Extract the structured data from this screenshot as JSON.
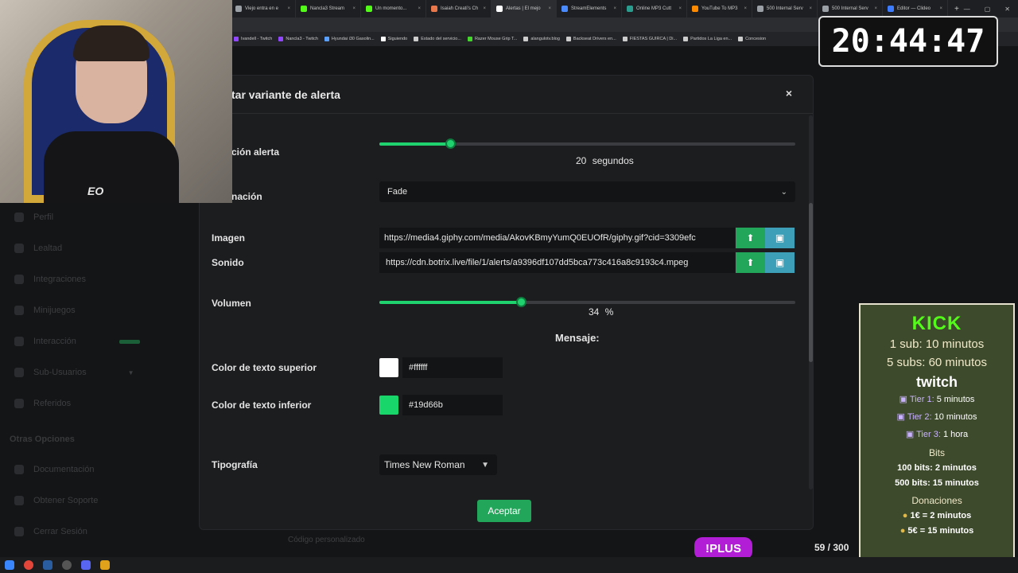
{
  "browser": {
    "tabs": [
      {
        "label": "Viejo entra en e",
        "color": "#9aa0a6"
      },
      {
        "label": "Nancla3 Stream",
        "color": "#53fc18"
      },
      {
        "label": "Un momento...",
        "color": "#53fc18"
      },
      {
        "label": "Isaiah Creati's Ch",
        "color": "#e8774c"
      },
      {
        "label": "Alertas | El mejo",
        "color": "#ffffff",
        "active": true
      },
      {
        "label": "StreamElements",
        "color": "#4a8cff"
      },
      {
        "label": "Online MP3 Cutt",
        "color": "#2a9d8f"
      },
      {
        "label": "YouTube To MP3",
        "color": "#ff8a00"
      },
      {
        "label": "500 Internal Serv",
        "color": "#9aa0a6"
      },
      {
        "label": "500 Internal Serv",
        "color": "#9aa0a6"
      },
      {
        "label": "Editor — Clideo",
        "color": "#3d7cff"
      }
    ],
    "new_tab": "+",
    "window_controls": [
      "—",
      "▢",
      "✕"
    ],
    "bookmarks": [
      {
        "label": "Ivandell - Twitch",
        "color": "#9146ff"
      },
      {
        "label": "Nancla3 - Twitch",
        "color": "#9146ff"
      },
      {
        "label": "Hyundai i30 Gasolin...",
        "color": "#5aa0ff"
      },
      {
        "label": "Siguiendo",
        "color": "#ffffff"
      },
      {
        "label": "Estado del servicio...",
        "color": "#cccccc"
      },
      {
        "label": "Razer Mouse Grip T...",
        "color": "#44d62c"
      },
      {
        "label": "alangulotv.blog",
        "color": "#cccccc"
      },
      {
        "label": "Backseat Drivers en...",
        "color": "#cccccc"
      },
      {
        "label": "FIESTAS GUIRCA | Di...",
        "color": "#cccccc"
      },
      {
        "label": "Partidos La Liga en...",
        "color": "#cccccc"
      },
      {
        "label": "Concesion",
        "color": "#cccccc"
      }
    ]
  },
  "sidebar": {
    "items": [
      "Perfil",
      "Lealtad",
      "Integraciones",
      "Minijuegos",
      "Interacción",
      "Sub-Usuarios",
      "Referidos"
    ],
    "section_title": "Otras Opciones",
    "bottom_items": [
      "Documentación",
      "Obtener Soporte",
      "Cerrar Sesión"
    ]
  },
  "modal": {
    "title": "tar variante de alerta",
    "close": "×",
    "duration": {
      "label": "ción alerta",
      "value_number": "20",
      "value_unit": "segundos",
      "fraction": 0.17
    },
    "animation": {
      "label": "nación",
      "selected": "Fade"
    },
    "image": {
      "label": "Imagen",
      "url": "https://media4.giphy.com/media/AkovKBmyYumQ0EUOfR/giphy.gif?cid=3309efc"
    },
    "sound": {
      "label": "Sonido",
      "url": "https://cdn.botrix.live/file/1/alerts/a9396df107dd5bca773c416a8c9193c4.mpeg"
    },
    "volume": {
      "label": "Volumen",
      "value_number": "34",
      "value_unit": "%",
      "fraction": 0.34
    },
    "message_heading": "Mensaje:",
    "top_color": {
      "label": "Color de texto superior",
      "hex": "#ffffff"
    },
    "bottom_color": {
      "label": "Color de texto inferior",
      "hex": "#19d66b"
    },
    "font": {
      "label": "Tipografía",
      "selected": "Times New Roman"
    },
    "accept": "Aceptar"
  },
  "clock": "20:44:47",
  "cam": {
    "shirt_text": "EO"
  },
  "promo": {
    "kick_title": "KICK",
    "kick_lines": [
      "1 sub: 10 minutos",
      "5 subs: 60 minutos"
    ],
    "twitch_title": "twitch",
    "tiers": [
      {
        "tier": "Tier 1:",
        "value": "5 minutos"
      },
      {
        "tier": "Tier 2:",
        "value": "10 minutos"
      },
      {
        "tier": "Tier 3:",
        "value": "1 hora"
      }
    ],
    "bits_title": "Bits",
    "bits_lines": [
      "100 bits: 2 minutos",
      "500 bits: 15 minutos"
    ],
    "donations_title": "Donaciones",
    "donation_lines": [
      "1€ = 2 minutos",
      "5€ = 15 minutos"
    ]
  },
  "footer": {
    "custom_code": "Código personalizado",
    "plus_badge": "!PLUS",
    "char_count": "59 / 300"
  },
  "colors": {
    "accent": "#22a75a",
    "gallery": "#3da0b8",
    "plus": "#b21ed6"
  }
}
